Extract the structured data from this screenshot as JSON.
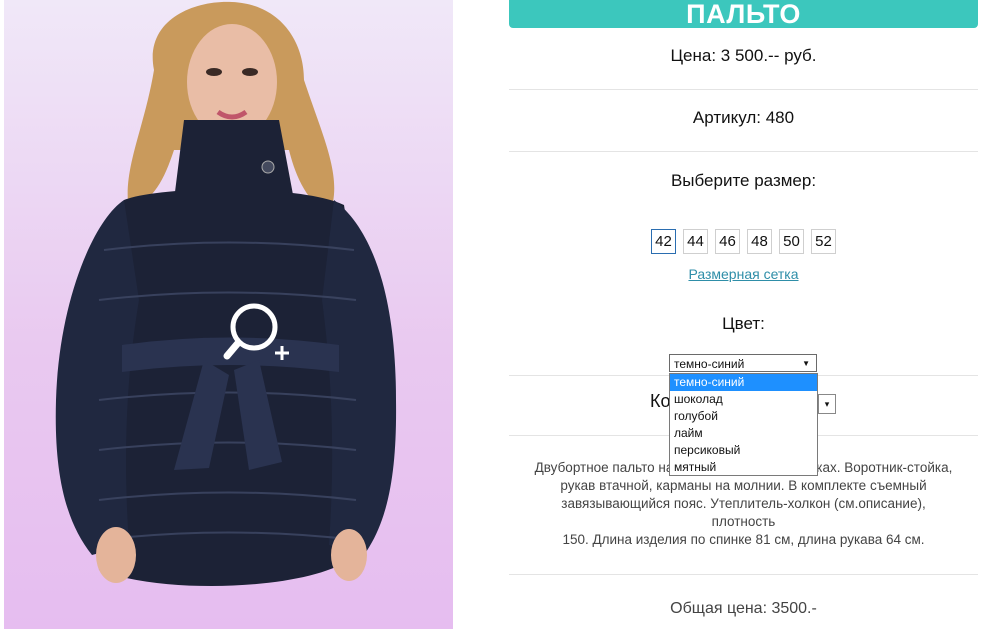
{
  "product": {
    "title": "ПАЛЬТО",
    "price": "Цена: 3 500.-- руб.",
    "article": "Артикул: 480",
    "size_title": "Выберите размер:",
    "sizes": [
      "42",
      "44",
      "46",
      "48",
      "50",
      "52"
    ],
    "size_chart_link": "Размерная сетка",
    "color_title": "Цвет:",
    "color_selected": "темно-синий",
    "color_options": [
      "темно-синий",
      "шоколад",
      "голубой",
      "лайм",
      "персиковый",
      "мятный"
    ],
    "qty_label_partial": "Ко",
    "description_lines": [
      "Двубортное пальто на                                    лках. Воротник-стойка,",
      "рукав втачной, карманы на молнии. В комплекте съемный",
      "завязывающийся пояс. Утеплитель-холкон (см.описание), плотность",
      "150. Длина изделия по спинке 81 см, длина рукава 64 см."
    ],
    "total": "Общая цена: 3500.-"
  },
  "icons": {
    "zoom": "magnifier-plus-icon",
    "select_arrow": "triangle-down-icon"
  },
  "colors": {
    "accent": "#3cc7bd",
    "link": "#2e8ea8",
    "selected_option": "#1e90ff",
    "photo_bg": "#e9c9f0",
    "coat": "#1c2236"
  }
}
